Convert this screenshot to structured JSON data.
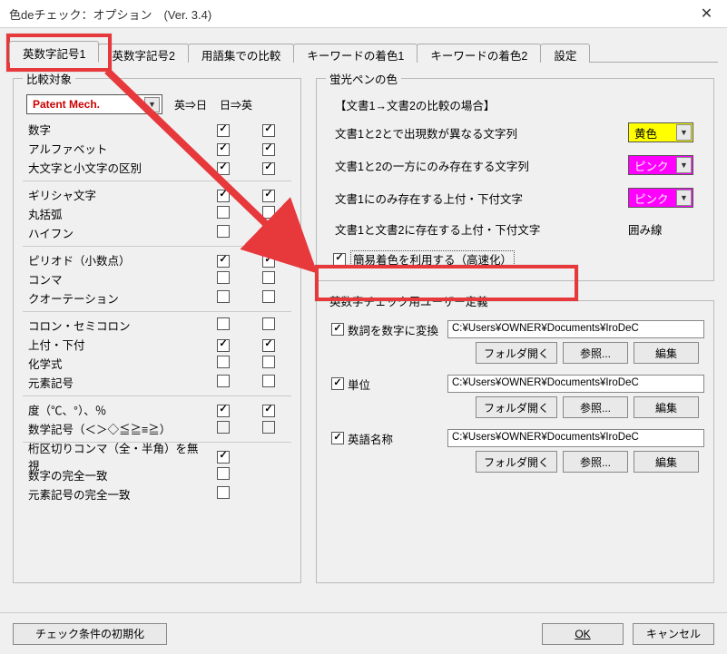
{
  "window": {
    "title": "色deチェック：オプション　(Ver. 3.4)"
  },
  "tabs": [
    {
      "label": "英数字記号1",
      "active": true
    },
    {
      "label": "英数字記号2"
    },
    {
      "label": "用語集での比較"
    },
    {
      "label": "キーワードの着色1"
    },
    {
      "label": "キーワードの着色2"
    },
    {
      "label": "設定"
    }
  ],
  "compare": {
    "legend": "比較対象",
    "profile": "Patent Mech.",
    "col_e2j": "英⇒日",
    "col_j2e": "日⇒英",
    "groups": [
      [
        {
          "label": "数字",
          "e": true,
          "j": true
        },
        {
          "label": "アルファベット",
          "e": true,
          "j": true
        },
        {
          "label": "大文字と小文字の区別",
          "e": true,
          "j": true
        }
      ],
      [
        {
          "label": "ギリシャ文字",
          "e": true,
          "j": true
        },
        {
          "label": "丸括弧",
          "e": false,
          "j": false
        },
        {
          "label": "ハイフン",
          "e": false,
          "j": false
        }
      ],
      [
        {
          "label": "ピリオド（小数点）",
          "e": true,
          "j": true
        },
        {
          "label": "コンマ",
          "e": false,
          "j": false
        },
        {
          "label": "クオーテーション",
          "e": false,
          "j": false
        }
      ],
      [
        {
          "label": "コロン・セミコロン",
          "e": false,
          "j": false
        },
        {
          "label": "上付・下付",
          "e": true,
          "j": true
        },
        {
          "label": "化学式",
          "e": false,
          "j": false
        },
        {
          "label": "元素記号",
          "e": false,
          "j": false
        }
      ],
      [
        {
          "label": "度（℃、°）、％",
          "e": true,
          "j": true
        },
        {
          "label": "数学記号（＜＞◇≦≧≡≧）",
          "e": false,
          "j": false,
          "readonly": true
        }
      ],
      [
        {
          "label": "桁区切りコンマ（全・半角）を無視",
          "single": true,
          "e": true
        },
        {
          "label": "数字の完全一致",
          "single": true,
          "e": false
        },
        {
          "label": "元素記号の完全一致",
          "single": true,
          "e": false
        }
      ]
    ]
  },
  "highlight": {
    "legend": "蛍光ペンの色",
    "subtitle": "【文書1→文書2の比較の場合】",
    "rows": [
      {
        "label": "文書1と2とで出現数が異なる文字列",
        "color_name": "黄色",
        "bg": "#ffff00",
        "fg": "#000"
      },
      {
        "label": "文書1と2の一方にのみ存在する文字列",
        "color_name": "ピンク",
        "bg": "#ff00ff",
        "fg": "#fff"
      },
      {
        "label": "文書1にのみ存在する上付・下付文字",
        "color_name": "ピンク",
        "bg": "#ff00ff",
        "fg": "#fff"
      }
    ],
    "row_box": {
      "label": "文書1と文書2に存在する上付・下付文字",
      "value": "囲み線"
    },
    "speed": {
      "checked": true,
      "label": "簡易着色を利用する（高速化）"
    }
  },
  "userdef": {
    "legend": "英数字チェック用ユーザー定義",
    "items": [
      {
        "checked": true,
        "label": "数詞を数字に変換",
        "path": "C:¥Users¥OWNER¥Documents¥IroDeC"
      },
      {
        "checked": true,
        "label": "単位",
        "path": "C:¥Users¥OWNER¥Documents¥IroDeC"
      },
      {
        "checked": true,
        "label": "英語名称",
        "path": "C:¥Users¥OWNER¥Documents¥IroDeC"
      }
    ],
    "btn_open": "フォルダ開く",
    "btn_browse": "参照...",
    "btn_edit": "編集"
  },
  "footer": {
    "reset": "チェック条件の初期化",
    "ok": "OK",
    "cancel": "キャンセル"
  }
}
